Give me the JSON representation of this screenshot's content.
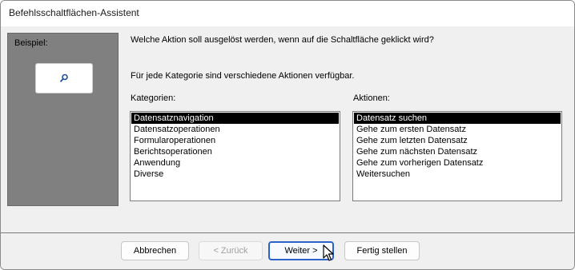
{
  "window": {
    "title": "Befehlsschaltflächen-Assistent"
  },
  "example": {
    "label": "Beispiel:",
    "icon": "search-icon"
  },
  "prompt": {
    "question": "Welche Aktion soll ausgelöst werden, wenn auf die Schaltfläche geklickt wird?",
    "info": "Für jede Kategorie sind verschiedene Aktionen verfügbar."
  },
  "categories": {
    "label": "Kategorien:",
    "selected": "Datensatznavigation",
    "items": [
      "Datensatznavigation",
      "Datensatzoperationen",
      "Formularoperationen",
      "Berichtsoperationen",
      "Anwendung",
      "Diverse"
    ]
  },
  "actions": {
    "label": "Aktionen:",
    "selected": "Datensatz suchen",
    "items": [
      "Datensatz suchen",
      "Gehe zum ersten Datensatz",
      "Gehe zum letzten Datensatz",
      "Gehe zum nächsten Datensatz",
      "Gehe zum vorherigen Datensatz",
      "Weitersuchen"
    ]
  },
  "buttons": {
    "cancel": "Abbrechen",
    "back": "< Zurück",
    "next": "Weiter >",
    "finish": "Fertig stellen"
  },
  "colors": {
    "selection": "#000000",
    "default_button_border": "#2a62c9",
    "example_panel": "#808080"
  }
}
